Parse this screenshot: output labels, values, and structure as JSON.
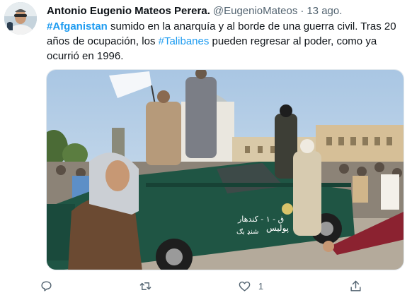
{
  "author": {
    "display_name": "Antonio Eugenio Mateos Perera.",
    "handle": "@EugenioMateos",
    "separator": "·",
    "timestamp": "13 ago."
  },
  "tweet": {
    "line1_hashtag": "#Afganistan",
    "line1_rest": " sumido en la anarquía y al borde de una guerra civil. Tras 20",
    "line2_start": "años de ocupación, los ",
    "line2_hashtag": "#Talibanes",
    "line2_rest": " pueden regresar al poder, como ya",
    "line3": "ocurrió en 1996."
  },
  "media": {
    "vehicle_text_1": "ق - ۱ - کندهار",
    "vehicle_text_2": "پولیس",
    "vehicle_text_3": "شنډ بګ"
  },
  "actions": {
    "reply_icon": "reply-icon",
    "retweet_icon": "retweet-icon",
    "like_icon": "heart-icon",
    "like_count": "1",
    "share_icon": "share-icon"
  },
  "colors": {
    "link": "#1d9bf0",
    "secondary_text": "#536471",
    "primary_text": "#0f1419"
  }
}
